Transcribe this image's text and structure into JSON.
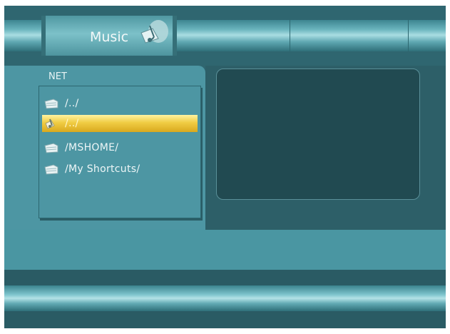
{
  "header": {
    "title": "Music",
    "icon": "music-note-icon"
  },
  "panel": {
    "heading": "NET",
    "items": [
      {
        "label": "/../",
        "icon": "folder-icon",
        "selected": false
      },
      {
        "label": "/../",
        "icon": "music-note-icon",
        "selected": true
      },
      {
        "label": "/MSHOME/",
        "icon": "folder-icon",
        "selected": false
      },
      {
        "label": "/My Shortcuts/",
        "icon": "folder-icon",
        "selected": false
      }
    ]
  },
  "colors": {
    "background": "#2f6670",
    "panel": "#4d96a3",
    "highlight": "#f0cc44",
    "preview": "#214a51"
  }
}
